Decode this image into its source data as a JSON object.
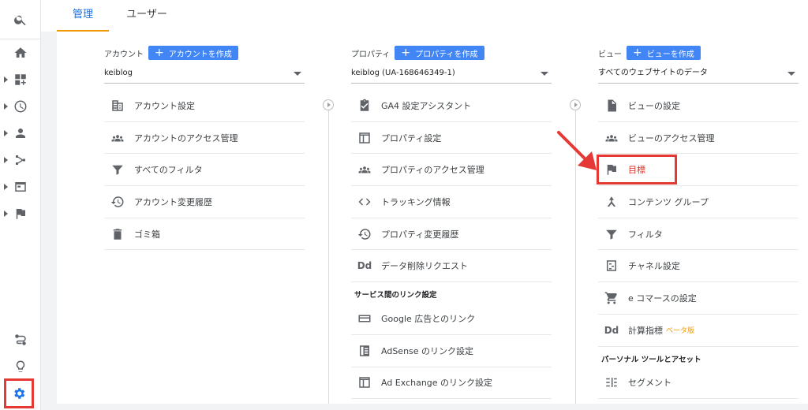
{
  "tabs": {
    "admin": "管理",
    "user": "ユーザー"
  },
  "account": {
    "label": "アカウント",
    "create": "アカウントを作成",
    "selected": "keiblog",
    "items": [
      {
        "label": "アカウント設定",
        "icon": "building-icon"
      },
      {
        "label": "アカウントのアクセス管理",
        "icon": "people-icon"
      },
      {
        "label": "すべてのフィルタ",
        "icon": "filter-icon"
      },
      {
        "label": "アカウント変更履歴",
        "icon": "history-icon"
      },
      {
        "label": "ゴミ箱",
        "icon": "trash-icon"
      }
    ]
  },
  "property": {
    "label": "プロパティ",
    "create": "プロパティを作成",
    "selected": "keiblog (UA-168646349-1)",
    "items": [
      {
        "label": "GA4 設定アシスタント",
        "icon": "checklist-icon"
      },
      {
        "label": "プロパティ設定",
        "icon": "window-icon"
      },
      {
        "label": "プロパティのアクセス管理",
        "icon": "people-icon"
      },
      {
        "label": "トラッキング情報",
        "icon": "code-icon"
      },
      {
        "label": "プロパティ変更履歴",
        "icon": "history-icon"
      },
      {
        "label": "データ削除リクエスト",
        "icon": "dd-icon"
      }
    ],
    "section": "サービス間のリンク設定",
    "links": [
      {
        "label": "Google 広告とのリンク",
        "icon": "ads-icon"
      },
      {
        "label": "AdSense のリンク設定",
        "icon": "adsense-icon"
      },
      {
        "label": "Ad Exchange のリンク設定",
        "icon": "window-icon"
      }
    ]
  },
  "view": {
    "label": "ビュー",
    "create": "ビューを作成",
    "selected": "すべてのウェブサイトのデータ",
    "items": [
      {
        "label": "ビューの設定",
        "icon": "document-icon"
      },
      {
        "label": "ビューのアクセス管理",
        "icon": "people-icon"
      },
      {
        "label": "目標",
        "icon": "flag-icon"
      },
      {
        "label": "コンテンツ グループ",
        "icon": "content-group-icon"
      },
      {
        "label": "フィルタ",
        "icon": "filter-icon"
      },
      {
        "label": "チャネル設定",
        "icon": "channel-icon"
      },
      {
        "label": "e コマースの設定",
        "icon": "cart-icon"
      },
      {
        "label": "計算指標",
        "icon": "dd-icon",
        "badge": "ベータ版"
      }
    ],
    "section": "パーソナル ツールとアセット",
    "links": [
      {
        "label": "セグメント",
        "icon": "segment-icon"
      }
    ]
  },
  "colors": {
    "accent": "#1a73e8",
    "button": "#4285f4",
    "highlight": "#e53935",
    "tab_underline": "#f29900"
  }
}
